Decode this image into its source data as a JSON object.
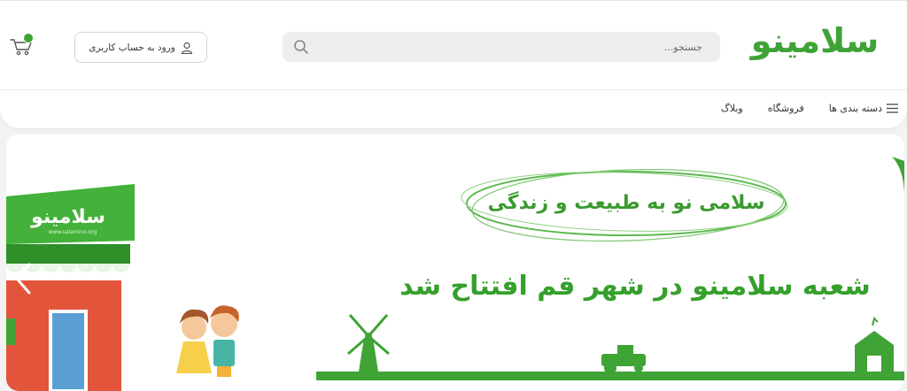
{
  "brand": {
    "logo_text": "سلامینو",
    "accent_color": "#3fa336"
  },
  "header": {
    "search_placeholder": "جستجو...",
    "search_icon": "search-icon",
    "login_label": "ورود به حساب کاربری",
    "login_icon": "user-icon",
    "cart_icon": "cart-icon"
  },
  "nav": {
    "items": [
      {
        "label": "دسته بندی ها",
        "icon": "menu-icon"
      },
      {
        "label": "فروشگاه"
      },
      {
        "label": "وبلاگ"
      }
    ]
  },
  "banner": {
    "slogan": "سلامی نو به طبیعت و زندگی",
    "headline": "شعبه سلامینو در شهر قم افتتاح شد",
    "shop_sign": "سلامینو",
    "shop_sign_small": "www.salamino.org",
    "prev_icon": "chevron-left-icon"
  }
}
